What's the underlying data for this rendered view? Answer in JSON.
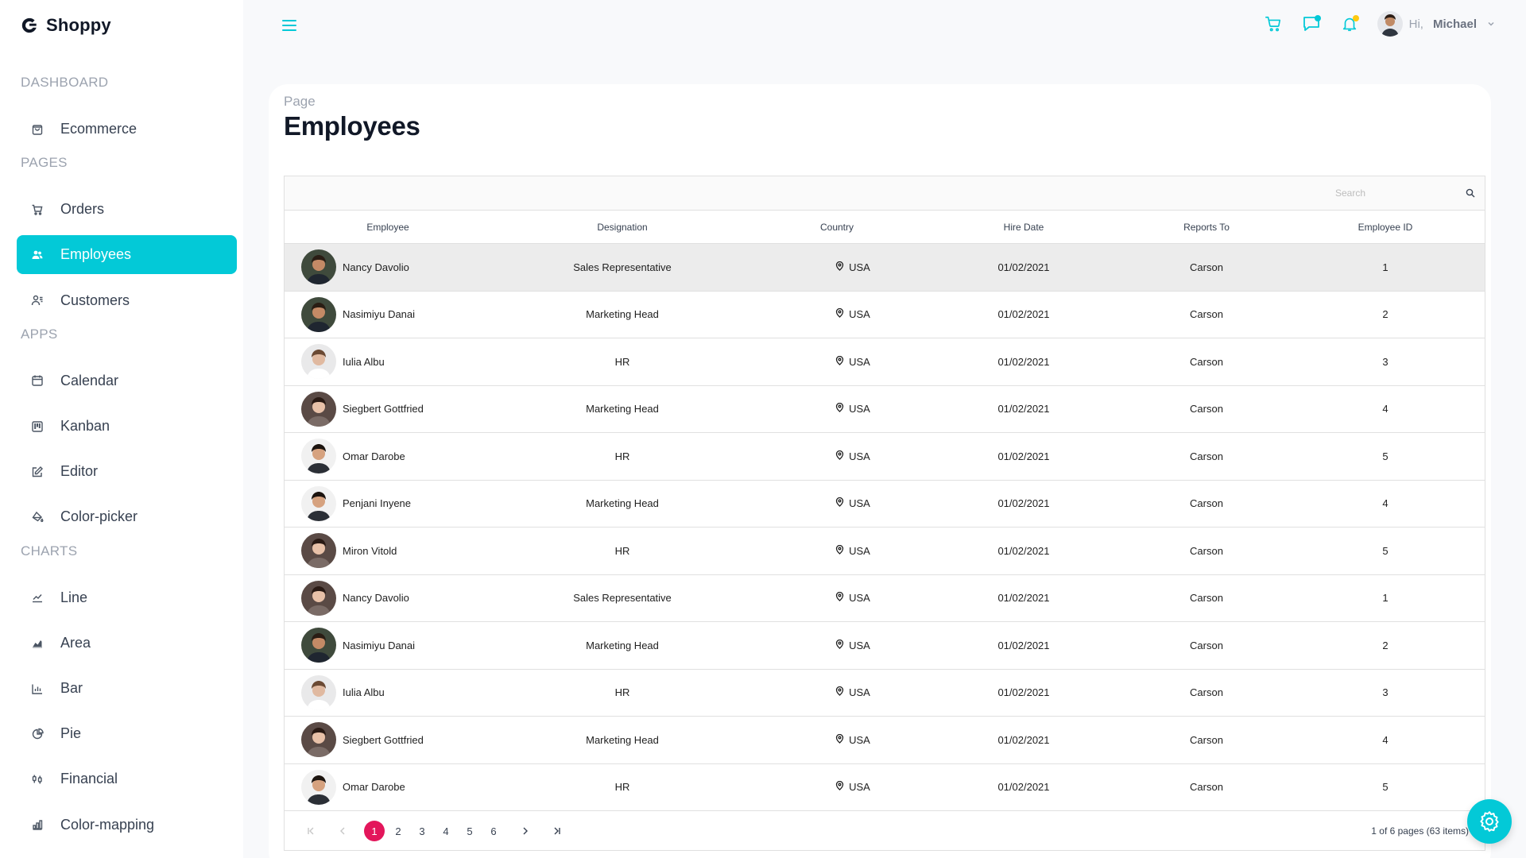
{
  "brand": {
    "name": "Shoppy"
  },
  "sidebar": {
    "sections": [
      {
        "title": "DASHBOARD",
        "items": [
          {
            "label": "Ecommerce",
            "icon": "shopping-bag-icon"
          }
        ]
      },
      {
        "title": "PAGES",
        "items": [
          {
            "label": "Orders",
            "icon": "cart-icon"
          },
          {
            "label": "Employees",
            "icon": "people-icon",
            "active": true
          },
          {
            "label": "Customers",
            "icon": "user-list-icon"
          }
        ]
      },
      {
        "title": "APPS",
        "items": [
          {
            "label": "Calendar",
            "icon": "calendar-icon"
          },
          {
            "label": "Kanban",
            "icon": "kanban-icon"
          },
          {
            "label": "Editor",
            "icon": "edit-icon"
          },
          {
            "label": "Color-picker",
            "icon": "paint-bucket-icon"
          }
        ]
      },
      {
        "title": "CHARTS",
        "items": [
          {
            "label": "Line",
            "icon": "line-chart-icon"
          },
          {
            "label": "Area",
            "icon": "area-chart-icon"
          },
          {
            "label": "Bar",
            "icon": "bar-chart-icon"
          },
          {
            "label": "Pie",
            "icon": "pie-chart-icon"
          },
          {
            "label": "Financial",
            "icon": "financial-icon"
          },
          {
            "label": "Color-mapping",
            "icon": "color-mapping-icon"
          }
        ]
      }
    ]
  },
  "topbar": {
    "greeting": "Hi,",
    "user_name": "Michael",
    "chat_dot_color": "#03c9d7",
    "notification_dot_color": "#fec90f",
    "icon_color": "#03c9d7"
  },
  "page": {
    "label": "Page",
    "title": "Employees"
  },
  "grid": {
    "search_placeholder": "Search",
    "columns": [
      "Employee",
      "Designation",
      "Country",
      "Hire Date",
      "Reports To",
      "Employee ID"
    ],
    "rows": [
      {
        "name": "Nancy Davolio",
        "designation": "Sales Representative",
        "country": "USA",
        "hire_date": "01/02/2021",
        "reports_to": "Carson",
        "id": "1",
        "avatar": "a1"
      },
      {
        "name": "Nasimiyu Danai",
        "designation": "Marketing Head",
        "country": "USA",
        "hire_date": "01/02/2021",
        "reports_to": "Carson",
        "id": "2",
        "avatar": "a1"
      },
      {
        "name": "Iulia Albu",
        "designation": "HR",
        "country": "USA",
        "hire_date": "01/02/2021",
        "reports_to": "Carson",
        "id": "3",
        "avatar": "a2"
      },
      {
        "name": "Siegbert Gottfried",
        "designation": "Marketing Head",
        "country": "USA",
        "hire_date": "01/02/2021",
        "reports_to": "Carson",
        "id": "4",
        "avatar": "a3"
      },
      {
        "name": "Omar Darobe",
        "designation": "HR",
        "country": "USA",
        "hire_date": "01/02/2021",
        "reports_to": "Carson",
        "id": "5",
        "avatar": "a4"
      },
      {
        "name": "Penjani Inyene",
        "designation": "Marketing Head",
        "country": "USA",
        "hire_date": "01/02/2021",
        "reports_to": "Carson",
        "id": "4",
        "avatar": "a4"
      },
      {
        "name": "Miron Vitold",
        "designation": "HR",
        "country": "USA",
        "hire_date": "01/02/2021",
        "reports_to": "Carson",
        "id": "5",
        "avatar": "a3"
      },
      {
        "name": "Nancy Davolio",
        "designation": "Sales Representative",
        "country": "USA",
        "hire_date": "01/02/2021",
        "reports_to": "Carson",
        "id": "1",
        "avatar": "a3"
      },
      {
        "name": "Nasimiyu Danai",
        "designation": "Marketing Head",
        "country": "USA",
        "hire_date": "01/02/2021",
        "reports_to": "Carson",
        "id": "2",
        "avatar": "a1"
      },
      {
        "name": "Iulia Albu",
        "designation": "HR",
        "country": "USA",
        "hire_date": "01/02/2021",
        "reports_to": "Carson",
        "id": "3",
        "avatar": "a2"
      },
      {
        "name": "Siegbert Gottfried",
        "designation": "Marketing Head",
        "country": "USA",
        "hire_date": "01/02/2021",
        "reports_to": "Carson",
        "id": "4",
        "avatar": "a3"
      },
      {
        "name": "Omar Darobe",
        "designation": "HR",
        "country": "USA",
        "hire_date": "01/02/2021",
        "reports_to": "Carson",
        "id": "5",
        "avatar": "a4"
      }
    ],
    "pager": {
      "pages": [
        "1",
        "2",
        "3",
        "4",
        "5",
        "6"
      ],
      "current": "1",
      "info": "1 of 6 pages (63 items)"
    }
  },
  "colors": {
    "accent": "#03c9d7",
    "pager_active": "#e3165b"
  }
}
